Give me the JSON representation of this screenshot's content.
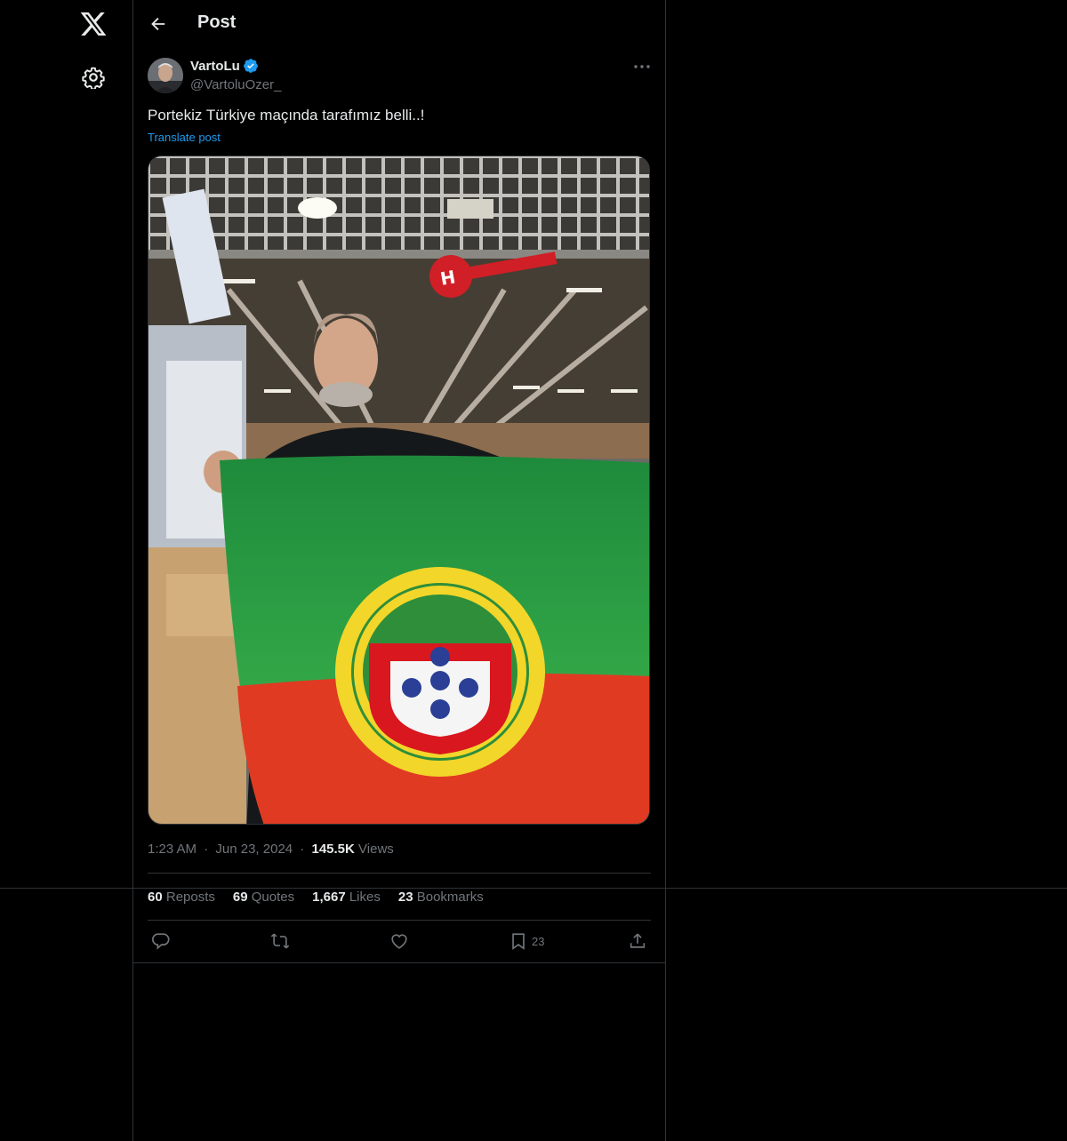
{
  "nav": {
    "logo_icon": "x-logo-icon",
    "settings_icon": "gear-icon"
  },
  "header": {
    "title": "Post"
  },
  "post": {
    "display_name": "VartoLu",
    "handle": "@VartoluOzer_",
    "verified": true,
    "text": "Portekiz Türkiye maçında tarafımız belli..!",
    "translate_label": "Translate post",
    "time": "1:23 AM",
    "separator": "·",
    "date": "Jun 23, 2024",
    "views_count": "145.5K",
    "views_label": "Views",
    "image_description_visible": false
  },
  "stats": {
    "reposts_count": "60",
    "reposts_label": "Reposts",
    "quotes_count": "69",
    "quotes_label": "Quotes",
    "likes_count": "1,667",
    "likes_label": "Likes",
    "bookmarks_count": "23",
    "bookmarks_label": "Bookmarks"
  },
  "actions": {
    "bookmark_count": "23"
  },
  "colors": {
    "background": "#000000",
    "text": "#e7e9ea",
    "secondary": "#71767b",
    "accent": "#1d9bf0",
    "border": "#2f3336"
  }
}
